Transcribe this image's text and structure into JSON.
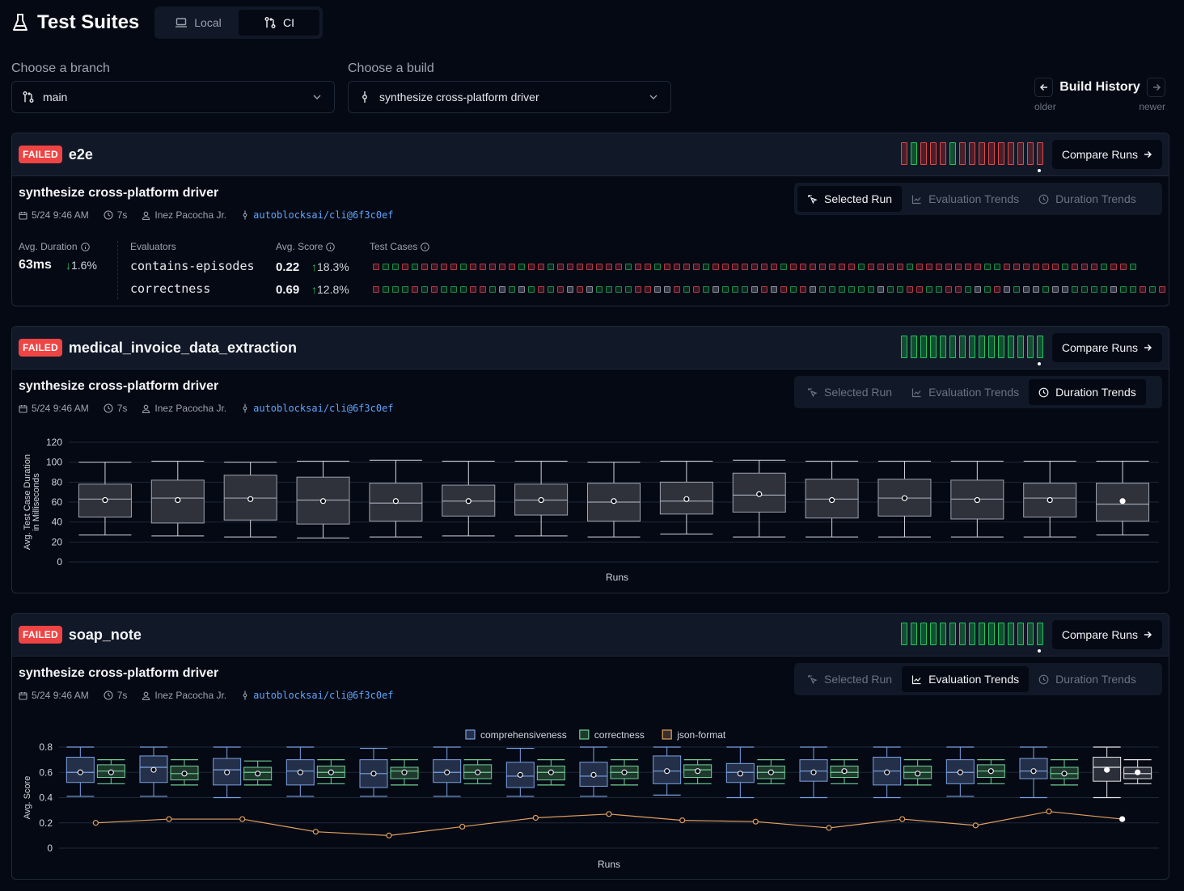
{
  "header": {
    "title": "Test Suites",
    "title_icon": "flask-icon",
    "modes": [
      {
        "label": "Local",
        "icon": "laptop-icon",
        "active": false
      },
      {
        "label": "CI",
        "icon": "git-pull-request-icon",
        "active": true
      }
    ]
  },
  "branch_select": {
    "label": "Choose a branch",
    "value": "main",
    "icon": "git-branch-icon"
  },
  "build_select": {
    "label": "Choose a build",
    "value": "synthesize cross-platform driver",
    "icon": "git-commit-icon"
  },
  "build_history": {
    "title": "Build History",
    "older": "older",
    "newer": "newer"
  },
  "common": {
    "failed_badge": "FAILED",
    "compare_runs": "Compare Runs",
    "tabs": [
      "Selected Run",
      "Evaluation Trends",
      "Duration Trends"
    ]
  },
  "suites": [
    {
      "name": "e2e",
      "status": "FAILED",
      "active_tab": "Selected Run",
      "run_history": [
        "fail",
        "pass",
        "fail",
        "fail",
        "fail",
        "pass",
        "fail",
        "fail",
        "fail",
        "fail",
        "fail",
        "fail",
        "fail",
        "fail",
        "fail"
      ],
      "build": {
        "title": "synthesize cross-platform driver",
        "date": "5/24 9:46 AM",
        "duration": "7s",
        "author": "Inez Pacocha Jr.",
        "commit": "autoblocksai/cli@6f3c0ef"
      },
      "stats": {
        "avg_duration_label": "Avg. Duration",
        "avg_duration": "63ms",
        "avg_duration_delta": "1.6%",
        "avg_duration_delta_dir": "down",
        "evaluators_label": "Evaluators",
        "avg_score_label": "Avg. Score",
        "test_cases_label": "Test Cases",
        "evaluators": [
          {
            "name": "contains-episodes",
            "score": "0.22",
            "delta": "18.3%",
            "dir": "up",
            "cases": "FPPFPFFFFPFFFFFPFFPFFFFFFFPFFPFFFFPFFFFFFFPFFFFFFFPFFFFPFFFFFFFPPFFFFFFPFFFPFFP"
          },
          {
            "name": "correctness",
            "score": "0.69",
            "delta": "12.8%",
            "dir": "up",
            "cases": "FPPPFPFPPPFFPSPSPFPFSFSPPPPFFSSFPFPSPPPSFSFPFSPPPPPPSPPFFPPFFPSPFSPSSPSSPPPPSPPFPF"
          }
        ]
      }
    },
    {
      "name": "medical_invoice_data_extraction",
      "status": "FAILED",
      "active_tab": "Duration Trends",
      "run_history": [
        "pass",
        "pass",
        "pass",
        "pass",
        "pass",
        "pass",
        "pass",
        "pass",
        "pass",
        "pass",
        "pass",
        "pass",
        "pass",
        "pass",
        "pass"
      ],
      "build": {
        "title": "synthesize cross-platform driver",
        "date": "5/24 9:46 AM",
        "duration": "7s",
        "author": "Inez Pacocha Jr.",
        "commit": "autoblocksai/cli@6f3c0ef"
      },
      "chart_data": {
        "type": "box",
        "title": "",
        "xlabel": "Runs",
        "ylabel": "Avg. Test Case Duration in Milliseconds",
        "ylim": [
          0,
          120
        ],
        "yticks": [
          0,
          20,
          40,
          60,
          80,
          100,
          120
        ],
        "grid": true,
        "series": [
          {
            "name": "duration",
            "boxes": [
              {
                "min": 27,
                "q1": 45,
                "median": 63,
                "q3": 78,
                "max": 100,
                "mean": 62
              },
              {
                "min": 26,
                "q1": 39,
                "median": 64,
                "q3": 82,
                "max": 101,
                "mean": 62
              },
              {
                "min": 25,
                "q1": 42,
                "median": 64,
                "q3": 87,
                "max": 100,
                "mean": 63
              },
              {
                "min": 24,
                "q1": 38,
                "median": 62,
                "q3": 85,
                "max": 101,
                "mean": 61
              },
              {
                "min": 25,
                "q1": 41,
                "median": 59,
                "q3": 79,
                "max": 102,
                "mean": 61
              },
              {
                "min": 26,
                "q1": 46,
                "median": 61,
                "q3": 77,
                "max": 101,
                "mean": 61
              },
              {
                "min": 26,
                "q1": 47,
                "median": 62,
                "q3": 78,
                "max": 101,
                "mean": 62
              },
              {
                "min": 25,
                "q1": 41,
                "median": 60,
                "q3": 79,
                "max": 100,
                "mean": 61
              },
              {
                "min": 28,
                "q1": 48,
                "median": 61,
                "q3": 80,
                "max": 101,
                "mean": 63
              },
              {
                "min": 25,
                "q1": 50,
                "median": 67,
                "q3": 89,
                "max": 102,
                "mean": 68
              },
              {
                "min": 25,
                "q1": 44,
                "median": 63,
                "q3": 83,
                "max": 101,
                "mean": 62
              },
              {
                "min": 25,
                "q1": 46,
                "median": 64,
                "q3": 83,
                "max": 101,
                "mean": 64
              },
              {
                "min": 25,
                "q1": 43,
                "median": 63,
                "q3": 82,
                "max": 101,
                "mean": 62
              },
              {
                "min": 25,
                "q1": 45,
                "median": 64,
                "q3": 79,
                "max": 101,
                "mean": 62
              },
              {
                "min": 27,
                "q1": 41,
                "median": 58,
                "q3": 79,
                "max": 101,
                "mean": 61
              }
            ]
          }
        ]
      }
    },
    {
      "name": "soap_note",
      "status": "FAILED",
      "active_tab": "Evaluation Trends",
      "run_history": [
        "pass",
        "pass",
        "pass",
        "pass",
        "pass",
        "pass",
        "pass",
        "pass",
        "pass",
        "pass",
        "pass",
        "pass",
        "pass",
        "pass",
        "pass"
      ],
      "build": {
        "title": "synthesize cross-platform driver",
        "date": "5/24 9:46 AM",
        "duration": "7s",
        "author": "Inez Pacocha Jr.",
        "commit": "autoblocksai/cli@6f3c0ef"
      },
      "chart_data": {
        "type": "box",
        "xlabel": "Runs",
        "ylabel": "Avg. Score",
        "ylim": [
          0,
          0.8
        ],
        "yticks": [
          0,
          0.2,
          0.4,
          0.6,
          0.8
        ],
        "grid": true,
        "legend": "top-center",
        "legend_entries": [
          "comprehensiveness",
          "correctness",
          "json-format"
        ],
        "colors": {
          "comprehensiveness": "#7aa2e3",
          "correctness": "#6fcf97",
          "json-format": "#e0a060"
        },
        "series": [
          {
            "name": "comprehensiveness",
            "type": "box",
            "boxes": [
              {
                "min": 0.41,
                "q1": 0.52,
                "median": 0.6,
                "q3": 0.72,
                "max": 0.8,
                "mean": 0.6
              },
              {
                "min": 0.41,
                "q1": 0.52,
                "median": 0.64,
                "q3": 0.73,
                "max": 0.8,
                "mean": 0.62
              },
              {
                "min": 0.4,
                "q1": 0.5,
                "median": 0.62,
                "q3": 0.71,
                "max": 0.8,
                "mean": 0.6
              },
              {
                "min": 0.41,
                "q1": 0.5,
                "median": 0.61,
                "q3": 0.7,
                "max": 0.8,
                "mean": 0.6
              },
              {
                "min": 0.41,
                "q1": 0.48,
                "median": 0.59,
                "q3": 0.7,
                "max": 0.79,
                "mean": 0.59
              },
              {
                "min": 0.41,
                "q1": 0.52,
                "median": 0.6,
                "q3": 0.7,
                "max": 0.8,
                "mean": 0.6
              },
              {
                "min": 0.41,
                "q1": 0.48,
                "median": 0.57,
                "q3": 0.68,
                "max": 0.79,
                "mean": 0.58
              },
              {
                "min": 0.41,
                "q1": 0.49,
                "median": 0.57,
                "q3": 0.68,
                "max": 0.8,
                "mean": 0.58
              },
              {
                "min": 0.42,
                "q1": 0.51,
                "median": 0.61,
                "q3": 0.73,
                "max": 0.8,
                "mean": 0.61
              },
              {
                "min": 0.4,
                "q1": 0.52,
                "median": 0.6,
                "q3": 0.67,
                "max": 0.8,
                "mean": 0.59
              },
              {
                "min": 0.4,
                "q1": 0.53,
                "median": 0.61,
                "q3": 0.7,
                "max": 0.8,
                "mean": 0.6
              },
              {
                "min": 0.4,
                "q1": 0.5,
                "median": 0.61,
                "q3": 0.72,
                "max": 0.8,
                "mean": 0.6
              },
              {
                "min": 0.41,
                "q1": 0.51,
                "median": 0.6,
                "q3": 0.7,
                "max": 0.8,
                "mean": 0.6
              },
              {
                "min": 0.4,
                "q1": 0.55,
                "median": 0.61,
                "q3": 0.71,
                "max": 0.8,
                "mean": 0.61
              },
              {
                "min": 0.4,
                "q1": 0.53,
                "median": 0.64,
                "q3": 0.72,
                "max": 0.8,
                "mean": 0.62
              }
            ]
          },
          {
            "name": "correctness",
            "type": "box",
            "boxes": [
              {
                "min": 0.51,
                "q1": 0.56,
                "median": 0.61,
                "q3": 0.66,
                "max": 0.7,
                "mean": 0.6
              },
              {
                "min": 0.5,
                "q1": 0.54,
                "median": 0.59,
                "q3": 0.65,
                "max": 0.7,
                "mean": 0.59
              },
              {
                "min": 0.5,
                "q1": 0.54,
                "median": 0.6,
                "q3": 0.64,
                "max": 0.69,
                "mean": 0.59
              },
              {
                "min": 0.51,
                "q1": 0.56,
                "median": 0.6,
                "q3": 0.65,
                "max": 0.7,
                "mean": 0.6
              },
              {
                "min": 0.5,
                "q1": 0.55,
                "median": 0.61,
                "q3": 0.64,
                "max": 0.7,
                "mean": 0.6
              },
              {
                "min": 0.51,
                "q1": 0.55,
                "median": 0.6,
                "q3": 0.66,
                "max": 0.7,
                "mean": 0.6
              },
              {
                "min": 0.5,
                "q1": 0.54,
                "median": 0.6,
                "q3": 0.65,
                "max": 0.7,
                "mean": 0.6
              },
              {
                "min": 0.5,
                "q1": 0.55,
                "median": 0.6,
                "q3": 0.65,
                "max": 0.7,
                "mean": 0.6
              },
              {
                "min": 0.51,
                "q1": 0.56,
                "median": 0.62,
                "q3": 0.66,
                "max": 0.7,
                "mean": 0.61
              },
              {
                "min": 0.51,
                "q1": 0.55,
                "median": 0.6,
                "q3": 0.65,
                "max": 0.7,
                "mean": 0.6
              },
              {
                "min": 0.51,
                "q1": 0.56,
                "median": 0.6,
                "q3": 0.65,
                "max": 0.7,
                "mean": 0.61
              },
              {
                "min": 0.5,
                "q1": 0.55,
                "median": 0.6,
                "q3": 0.65,
                "max": 0.7,
                "mean": 0.59
              },
              {
                "min": 0.51,
                "q1": 0.56,
                "median": 0.61,
                "q3": 0.66,
                "max": 0.7,
                "mean": 0.61
              },
              {
                "min": 0.5,
                "q1": 0.55,
                "median": 0.59,
                "q3": 0.64,
                "max": 0.7,
                "mean": 0.59
              },
              {
                "min": 0.51,
                "q1": 0.55,
                "median": 0.59,
                "q3": 0.64,
                "max": 0.7,
                "mean": 0.6
              }
            ]
          },
          {
            "name": "json-format",
            "type": "line",
            "values": [
              0.2,
              0.23,
              0.23,
              0.13,
              0.1,
              0.17,
              0.24,
              0.27,
              0.22,
              0.21,
              0.16,
              0.23,
              0.18,
              0.29,
              0.23
            ]
          }
        ]
      }
    }
  ]
}
